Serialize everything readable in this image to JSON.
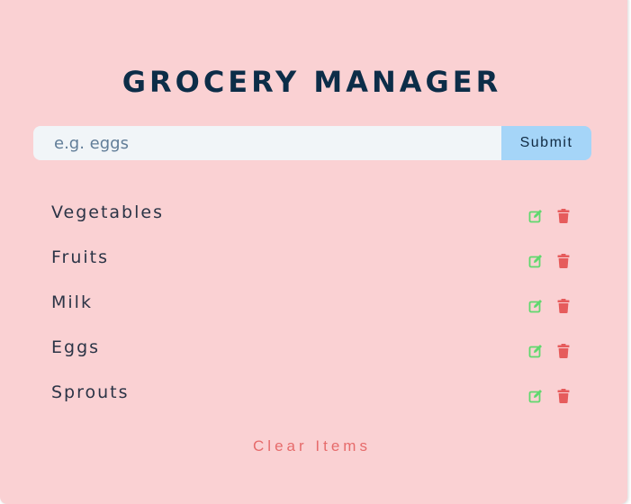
{
  "title": "GROCERY MANAGER",
  "form": {
    "placeholder": "e.g. eggs",
    "value": "",
    "submit_label": "Submit"
  },
  "items": [
    {
      "name": "Vegetables"
    },
    {
      "name": "Fruits"
    },
    {
      "name": "Milk"
    },
    {
      "name": "Eggs"
    },
    {
      "name": "Sprouts"
    }
  ],
  "clear_label": "Clear Items",
  "icons": {
    "edit": "edit-icon",
    "delete": "trash-icon"
  },
  "colors": {
    "background": "#fad1d3",
    "title": "#0c2d48",
    "input_bg": "#f1f5f8",
    "submit_bg": "#a5d5f8",
    "edit": "#5fd86e",
    "delete": "#e65c5c",
    "clear": "#e66b6b"
  }
}
